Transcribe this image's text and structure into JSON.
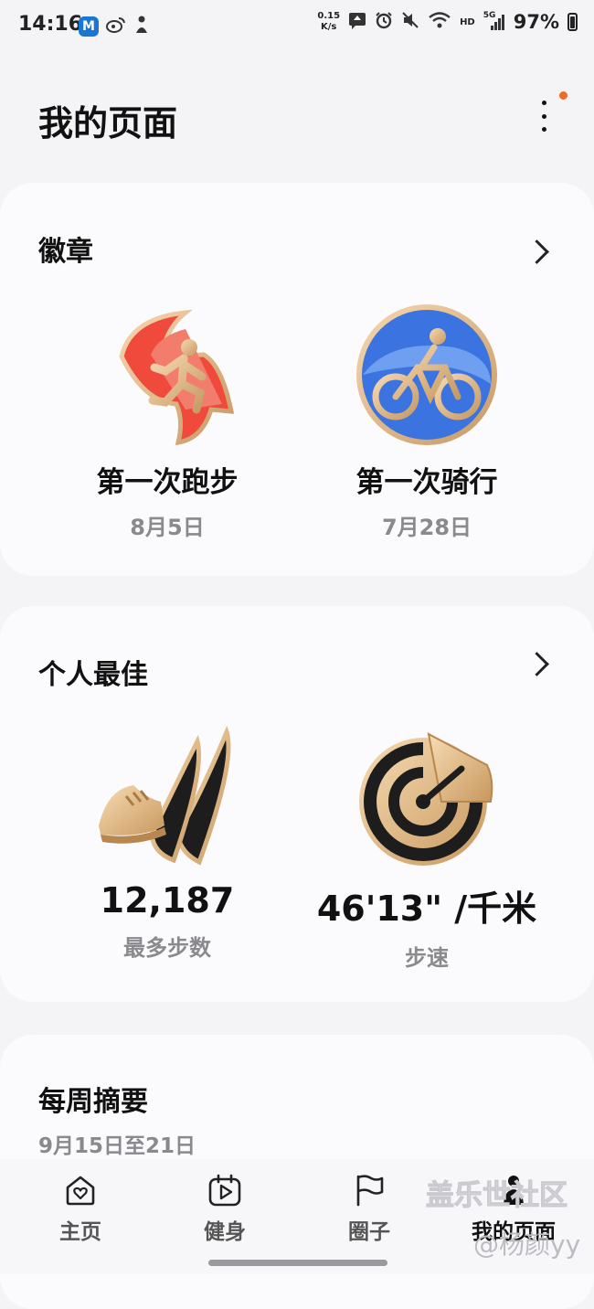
{
  "status_bar": {
    "time": "14:16",
    "app_icon_m": "M",
    "net_speed_top": "0.15",
    "net_speed_bottom": "K/s",
    "hd_label": "HD",
    "signal_label": "5G",
    "battery": "97%",
    "icons": [
      "m-app-icon",
      "weibo-icon",
      "figure-icon",
      "upload-icon",
      "alarm-icon",
      "mute-icon",
      "wifi-icon",
      "signal-icon",
      "battery-icon"
    ]
  },
  "page": {
    "title": "我的页面"
  },
  "badges": {
    "title": "徽章",
    "items": [
      {
        "name": "第一次跑步",
        "date": "8月5日",
        "icon": "running-badge-icon"
      },
      {
        "name": "第一次骑行",
        "date": "7月28日",
        "icon": "cycling-badge-icon"
      }
    ]
  },
  "personal_best": {
    "title": "个人最佳",
    "items": [
      {
        "value": "12,187",
        "label": "最多步数",
        "icon": "shoe-badge-icon"
      },
      {
        "value": "46'13\" /千米",
        "label": "步速",
        "icon": "pace-gauge-icon"
      }
    ]
  },
  "weekly": {
    "title": "每周摘要",
    "range": "9月15日至21日"
  },
  "tabs": [
    {
      "label": "主页",
      "icon": "home-heart-icon"
    },
    {
      "label": "健身",
      "icon": "fitness-play-icon"
    },
    {
      "label": "圈子",
      "icon": "flag-icon"
    },
    {
      "label": "我的页面",
      "icon": "person-icon"
    }
  ],
  "watermark": {
    "line1": "盖乐世社区",
    "line2": "@杨颜yy"
  },
  "colors": {
    "accent_dot": "#f06a22",
    "run_red": "#ef4a3c",
    "ride_blue": "#3b74e0",
    "gold": "#e6c190"
  }
}
